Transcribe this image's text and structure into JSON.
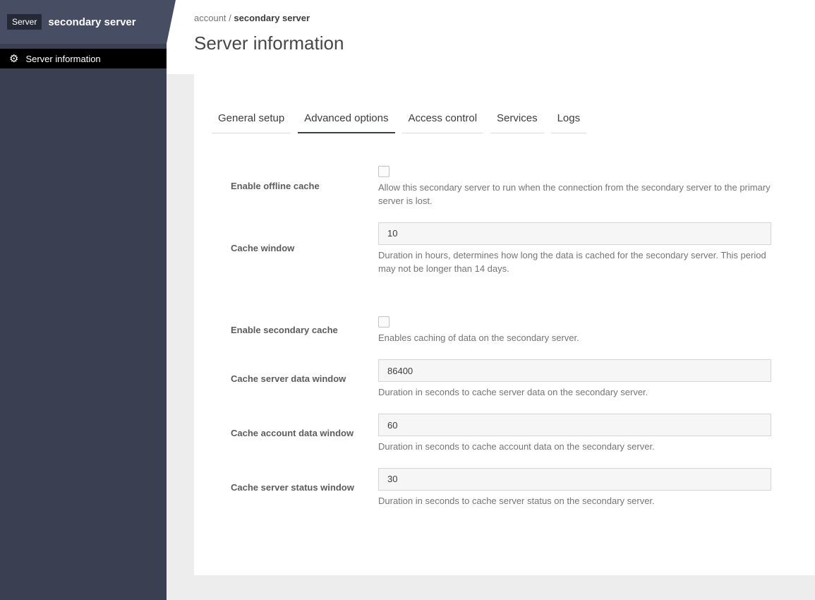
{
  "colors": {
    "sidebar": "#3a3f51",
    "sidebar_header": "#474d63",
    "badge_bg": "#262a36",
    "nav_active_bg": "#000000",
    "accent_underline": "#3a3f51",
    "page_bg": "#ededed"
  },
  "sidebar": {
    "badge": "Server",
    "title": "secondary server",
    "nav": [
      {
        "label": "Server information",
        "icon": "gear-icon",
        "active": true
      }
    ]
  },
  "header": {
    "breadcrumb": {
      "parent": "account",
      "separator": " / ",
      "current": "secondary server"
    },
    "title": "Server information"
  },
  "tabs": [
    {
      "label": "General setup",
      "active": false
    },
    {
      "label": "Advanced options",
      "active": true
    },
    {
      "label": "Access control",
      "active": false
    },
    {
      "label": "Services",
      "active": false
    },
    {
      "label": "Logs",
      "active": false
    }
  ],
  "form": {
    "rows": [
      {
        "type": "checkbox",
        "label": "Enable offline cache",
        "checked": false,
        "help": "Allow this secondary server to run when the connection from the secondary server to the primary server is lost.",
        "spacing": "normal"
      },
      {
        "type": "input",
        "label": "Cache window",
        "value": "10",
        "help": "Duration in hours, determines how long the data is cached for the secondary server. This period may not be longer than 14 days.",
        "spacing": "normal"
      },
      {
        "type": "checkbox",
        "label": "Enable secondary cache",
        "checked": false,
        "help": "Enables caching of data on the secondary server.",
        "spacing": "large"
      },
      {
        "type": "input",
        "label": "Cache server data window",
        "value": "86400",
        "help": "Duration in seconds to cache server data on the secondary server.",
        "spacing": "normal"
      },
      {
        "type": "input",
        "label": "Cache account data window",
        "value": "60",
        "help": "Duration in seconds to cache account data on the secondary server.",
        "spacing": "normal"
      },
      {
        "type": "input",
        "label": "Cache server status window",
        "value": "30",
        "help": "Duration in seconds to cache server status on the secondary server.",
        "spacing": "normal"
      }
    ]
  }
}
